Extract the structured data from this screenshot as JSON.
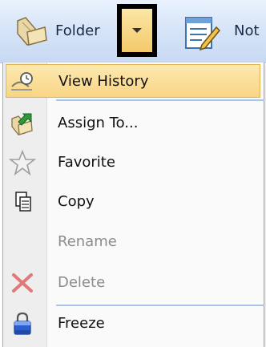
{
  "toolbar": {
    "folder_label": "Folder",
    "notes_label": "Not"
  },
  "menu": {
    "items": [
      {
        "label": "View History",
        "icon": "history-icon",
        "state": "highlighted"
      },
      {
        "label": "Assign To...",
        "icon": "assign-icon",
        "state": "enabled"
      },
      {
        "label": "Favorite",
        "icon": "star-icon",
        "state": "enabled"
      },
      {
        "label": "Copy",
        "icon": "copy-icon",
        "state": "enabled"
      },
      {
        "label": "Rename",
        "icon": "",
        "state": "disabled"
      },
      {
        "label": "Delete",
        "icon": "delete-icon",
        "state": "disabled"
      },
      {
        "label": "Freeze",
        "icon": "freeze-icon",
        "state": "enabled"
      }
    ]
  },
  "colors": {
    "highlight": "#f8d585",
    "accent_separator": "#a6c6e8",
    "disabled_text": "#8c8c8c"
  }
}
